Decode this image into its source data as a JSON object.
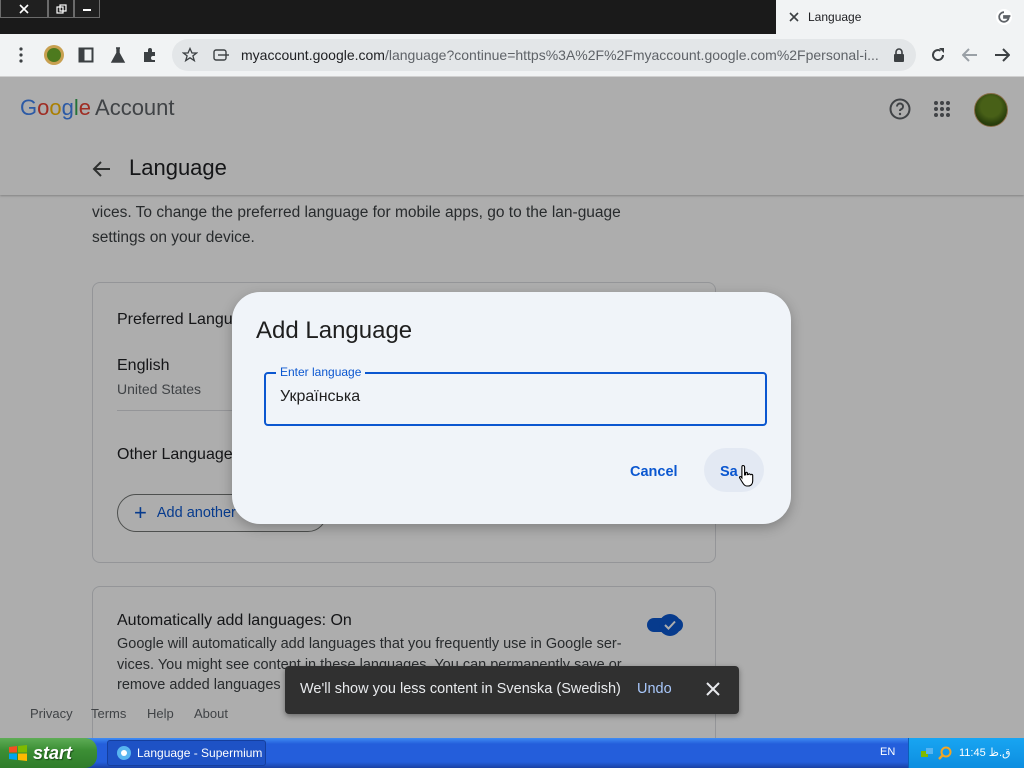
{
  "browser": {
    "window_controls": [
      "close",
      "restore",
      "minimize"
    ],
    "tab": {
      "title": "Language",
      "favicon": "google-g-icon"
    },
    "omnibox": {
      "url_host": "myaccount.google.com",
      "url_rest": "/language?continue=https%3A%2F%2Fmyaccount.google.com%2Fpersonal-i..."
    }
  },
  "header": {
    "logo_google": [
      "G",
      "o",
      "o",
      "g",
      "l",
      "e"
    ],
    "logo_account": "Account",
    "page_title": "Language"
  },
  "page": {
    "description": "vices. To change the preferred language for mobile apps, go to the lan-guage settings on your device.",
    "preferred": {
      "heading": "Preferred Langu",
      "language": "English",
      "region": "United States"
    },
    "other": {
      "heading": "Other Language",
      "add_button": "Add another"
    },
    "auto": {
      "title": "Automatically add languages: On",
      "description": "Google will automatically add languages that you frequently use in Google ser-vices. You might see content in these languages. You can permanently save or remove added languages a",
      "toggle_on": true
    },
    "footer": [
      "Privacy",
      "Terms",
      "Help",
      "About"
    ]
  },
  "dialog": {
    "title": "Add Language",
    "field_label": "Enter language",
    "field_value": "Українська",
    "cancel": "Cancel",
    "save": "Sa"
  },
  "snackbar": {
    "message": "We'll show you less content in Svenska (Swedish)",
    "action": "Undo"
  },
  "taskbar": {
    "start": "start",
    "task": "Language - Supermium",
    "language": "EN",
    "clock": "11:45 ق.ظ"
  }
}
